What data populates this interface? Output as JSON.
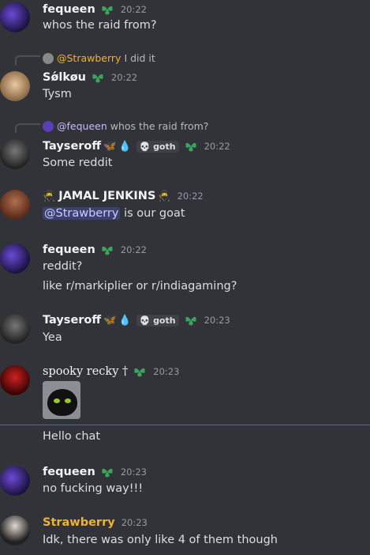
{
  "messages": {
    "m1": {
      "author": "fequeen",
      "time": "20:22",
      "text": "whos the raid from?"
    },
    "m2": {
      "reply_author": "@Strawberry",
      "reply_text": "I did it",
      "author": "Sǿlkøu",
      "time": "20:22",
      "text": "Tysm"
    },
    "m3": {
      "reply_author": "@fequeen",
      "reply_text": "whos the raid from?",
      "author": "Tayseroff",
      "tag": "goth",
      "time": "20:22",
      "text": "Some reddit"
    },
    "m4": {
      "author": "JAMAL JENKINS",
      "time": "20:22",
      "mention": "@Strawberry",
      "text": " is our goat"
    },
    "m5": {
      "author": "fequeen",
      "time": "20:22",
      "line1": "reddit?",
      "line2": "like r/markiplier or r/indiagaming?"
    },
    "m6": {
      "author": "Tayseroff",
      "tag": "goth",
      "time": "20:23",
      "text": "Yea"
    },
    "m7": {
      "author": "spooky recky †",
      "time": "20:23"
    },
    "m8": {
      "text": "Hello chat"
    },
    "m9": {
      "author": "fequeen",
      "time": "20:23",
      "text": "no fucking way!!!"
    },
    "m10": {
      "author": "Strawberry",
      "time": "20:23",
      "text": "Idk, there was only like 4 of them though"
    }
  },
  "colors": {
    "background": "#313338",
    "mention_bg": "#3c4270",
    "new_divider": "#f23f43",
    "strawberry_name": "#f0b232",
    "leaf_icon": "#3ba55c"
  }
}
